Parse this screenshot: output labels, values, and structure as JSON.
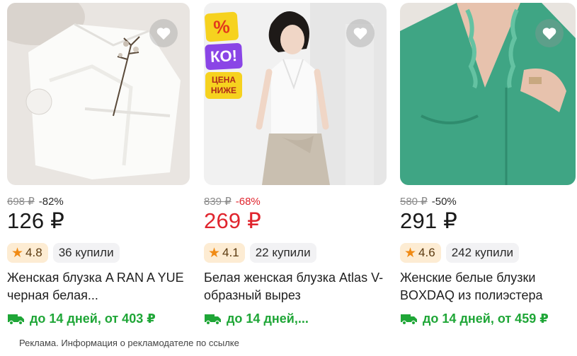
{
  "colors": {
    "accent_red": "#e0252e",
    "delivery_green": "#1fa637",
    "rating_star": "#f08a14",
    "rating_bg": "#fdecd3"
  },
  "products": [
    {
      "old_price": "698 ₽",
      "discount": "-82%",
      "price": "126 ₽",
      "rating": "4.8",
      "bought": "36 купили",
      "title": "Женская блузка A RAN A YUE черная белая...",
      "delivery": "до 14 дней, от 403 ₽",
      "image": "white-lace-blouse-flatlay"
    },
    {
      "old_price": "839 ₽",
      "discount": "-68%",
      "price": "269 ₽",
      "rating": "4.1",
      "bought": "22 купили",
      "title": "Белая женская блузка Atlas V-образный вырез",
      "delivery": "до 14 дней,...",
      "image": "white-sleeveless-blouse-model",
      "sticker": {
        "percent": "%",
        "ko": "КО!",
        "line1": "ЦЕНА",
        "line2": "НИЖЕ"
      }
    },
    {
      "old_price": "580 ₽",
      "discount": "-50%",
      "price": "291 ₽",
      "rating": "4.6",
      "bought": "242 купили",
      "title": "Женские белые блузки BOXDAQ из полиэстера",
      "delivery": "до 14 дней, от 459 ₽",
      "image": "green-ruffle-blouse-model"
    }
  ],
  "ad_note": "Реклама. Информация о рекламодателе по ссылке"
}
